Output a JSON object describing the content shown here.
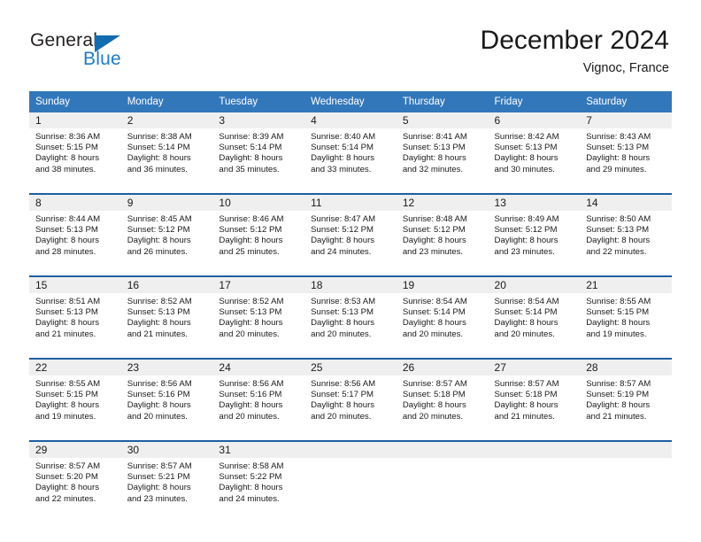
{
  "logo": {
    "word_one": "General",
    "word_two": "Blue",
    "triangle_color": "#136bb0",
    "blue_text_color": "#1d7dc4"
  },
  "header": {
    "title": "December 2024",
    "subtitle": "Vignoc, France"
  },
  "theme": {
    "header_blue": "#3377bb",
    "row_border_blue": "#1f5fa0",
    "day_strip_gray": "#efefef"
  },
  "weekdays": [
    "Sunday",
    "Monday",
    "Tuesday",
    "Wednesday",
    "Thursday",
    "Friday",
    "Saturday"
  ],
  "weeks": [
    [
      {
        "day": "1",
        "sunrise": "Sunrise: 8:36 AM",
        "sunset": "Sunset: 5:15 PM",
        "daylight1": "Daylight: 8 hours",
        "daylight2": "and 38 minutes."
      },
      {
        "day": "2",
        "sunrise": "Sunrise: 8:38 AM",
        "sunset": "Sunset: 5:14 PM",
        "daylight1": "Daylight: 8 hours",
        "daylight2": "and 36 minutes."
      },
      {
        "day": "3",
        "sunrise": "Sunrise: 8:39 AM",
        "sunset": "Sunset: 5:14 PM",
        "daylight1": "Daylight: 8 hours",
        "daylight2": "and 35 minutes."
      },
      {
        "day": "4",
        "sunrise": "Sunrise: 8:40 AM",
        "sunset": "Sunset: 5:14 PM",
        "daylight1": "Daylight: 8 hours",
        "daylight2": "and 33 minutes."
      },
      {
        "day": "5",
        "sunrise": "Sunrise: 8:41 AM",
        "sunset": "Sunset: 5:13 PM",
        "daylight1": "Daylight: 8 hours",
        "daylight2": "and 32 minutes."
      },
      {
        "day": "6",
        "sunrise": "Sunrise: 8:42 AM",
        "sunset": "Sunset: 5:13 PM",
        "daylight1": "Daylight: 8 hours",
        "daylight2": "and 30 minutes."
      },
      {
        "day": "7",
        "sunrise": "Sunrise: 8:43 AM",
        "sunset": "Sunset: 5:13 PM",
        "daylight1": "Daylight: 8 hours",
        "daylight2": "and 29 minutes."
      }
    ],
    [
      {
        "day": "8",
        "sunrise": "Sunrise: 8:44 AM",
        "sunset": "Sunset: 5:13 PM",
        "daylight1": "Daylight: 8 hours",
        "daylight2": "and 28 minutes."
      },
      {
        "day": "9",
        "sunrise": "Sunrise: 8:45 AM",
        "sunset": "Sunset: 5:12 PM",
        "daylight1": "Daylight: 8 hours",
        "daylight2": "and 26 minutes."
      },
      {
        "day": "10",
        "sunrise": "Sunrise: 8:46 AM",
        "sunset": "Sunset: 5:12 PM",
        "daylight1": "Daylight: 8 hours",
        "daylight2": "and 25 minutes."
      },
      {
        "day": "11",
        "sunrise": "Sunrise: 8:47 AM",
        "sunset": "Sunset: 5:12 PM",
        "daylight1": "Daylight: 8 hours",
        "daylight2": "and 24 minutes."
      },
      {
        "day": "12",
        "sunrise": "Sunrise: 8:48 AM",
        "sunset": "Sunset: 5:12 PM",
        "daylight1": "Daylight: 8 hours",
        "daylight2": "and 23 minutes."
      },
      {
        "day": "13",
        "sunrise": "Sunrise: 8:49 AM",
        "sunset": "Sunset: 5:12 PM",
        "daylight1": "Daylight: 8 hours",
        "daylight2": "and 23 minutes."
      },
      {
        "day": "14",
        "sunrise": "Sunrise: 8:50 AM",
        "sunset": "Sunset: 5:13 PM",
        "daylight1": "Daylight: 8 hours",
        "daylight2": "and 22 minutes."
      }
    ],
    [
      {
        "day": "15",
        "sunrise": "Sunrise: 8:51 AM",
        "sunset": "Sunset: 5:13 PM",
        "daylight1": "Daylight: 8 hours",
        "daylight2": "and 21 minutes."
      },
      {
        "day": "16",
        "sunrise": "Sunrise: 8:52 AM",
        "sunset": "Sunset: 5:13 PM",
        "daylight1": "Daylight: 8 hours",
        "daylight2": "and 21 minutes."
      },
      {
        "day": "17",
        "sunrise": "Sunrise: 8:52 AM",
        "sunset": "Sunset: 5:13 PM",
        "daylight1": "Daylight: 8 hours",
        "daylight2": "and 20 minutes."
      },
      {
        "day": "18",
        "sunrise": "Sunrise: 8:53 AM",
        "sunset": "Sunset: 5:13 PM",
        "daylight1": "Daylight: 8 hours",
        "daylight2": "and 20 minutes."
      },
      {
        "day": "19",
        "sunrise": "Sunrise: 8:54 AM",
        "sunset": "Sunset: 5:14 PM",
        "daylight1": "Daylight: 8 hours",
        "daylight2": "and 20 minutes."
      },
      {
        "day": "20",
        "sunrise": "Sunrise: 8:54 AM",
        "sunset": "Sunset: 5:14 PM",
        "daylight1": "Daylight: 8 hours",
        "daylight2": "and 20 minutes."
      },
      {
        "day": "21",
        "sunrise": "Sunrise: 8:55 AM",
        "sunset": "Sunset: 5:15 PM",
        "daylight1": "Daylight: 8 hours",
        "daylight2": "and 19 minutes."
      }
    ],
    [
      {
        "day": "22",
        "sunrise": "Sunrise: 8:55 AM",
        "sunset": "Sunset: 5:15 PM",
        "daylight1": "Daylight: 8 hours",
        "daylight2": "and 19 minutes."
      },
      {
        "day": "23",
        "sunrise": "Sunrise: 8:56 AM",
        "sunset": "Sunset: 5:16 PM",
        "daylight1": "Daylight: 8 hours",
        "daylight2": "and 20 minutes."
      },
      {
        "day": "24",
        "sunrise": "Sunrise: 8:56 AM",
        "sunset": "Sunset: 5:16 PM",
        "daylight1": "Daylight: 8 hours",
        "daylight2": "and 20 minutes."
      },
      {
        "day": "25",
        "sunrise": "Sunrise: 8:56 AM",
        "sunset": "Sunset: 5:17 PM",
        "daylight1": "Daylight: 8 hours",
        "daylight2": "and 20 minutes."
      },
      {
        "day": "26",
        "sunrise": "Sunrise: 8:57 AM",
        "sunset": "Sunset: 5:18 PM",
        "daylight1": "Daylight: 8 hours",
        "daylight2": "and 20 minutes."
      },
      {
        "day": "27",
        "sunrise": "Sunrise: 8:57 AM",
        "sunset": "Sunset: 5:18 PM",
        "daylight1": "Daylight: 8 hours",
        "daylight2": "and 21 minutes."
      },
      {
        "day": "28",
        "sunrise": "Sunrise: 8:57 AM",
        "sunset": "Sunset: 5:19 PM",
        "daylight1": "Daylight: 8 hours",
        "daylight2": "and 21 minutes."
      }
    ],
    [
      {
        "day": "29",
        "sunrise": "Sunrise: 8:57 AM",
        "sunset": "Sunset: 5:20 PM",
        "daylight1": "Daylight: 8 hours",
        "daylight2": "and 22 minutes."
      },
      {
        "day": "30",
        "sunrise": "Sunrise: 8:57 AM",
        "sunset": "Sunset: 5:21 PM",
        "daylight1": "Daylight: 8 hours",
        "daylight2": "and 23 minutes."
      },
      {
        "day": "31",
        "sunrise": "Sunrise: 8:58 AM",
        "sunset": "Sunset: 5:22 PM",
        "daylight1": "Daylight: 8 hours",
        "daylight2": "and 24 minutes."
      },
      {
        "day": "",
        "sunrise": "",
        "sunset": "",
        "daylight1": "",
        "daylight2": ""
      },
      {
        "day": "",
        "sunrise": "",
        "sunset": "",
        "daylight1": "",
        "daylight2": ""
      },
      {
        "day": "",
        "sunrise": "",
        "sunset": "",
        "daylight1": "",
        "daylight2": ""
      },
      {
        "day": "",
        "sunrise": "",
        "sunset": "",
        "daylight1": "",
        "daylight2": ""
      }
    ]
  ]
}
